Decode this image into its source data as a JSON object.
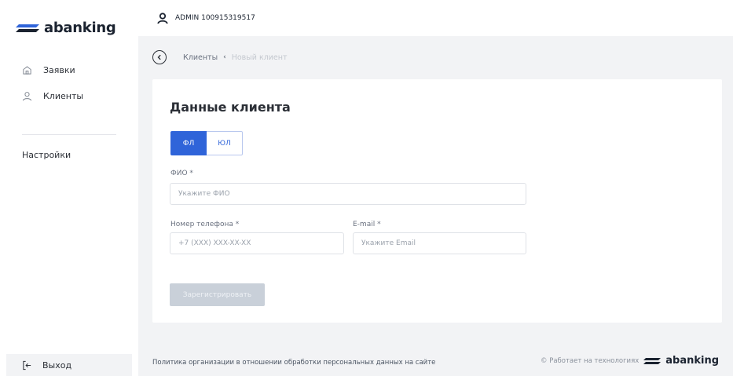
{
  "brand": {
    "name": "abanking",
    "accent": "#2f64d9"
  },
  "sidebar": {
    "items": [
      {
        "label": "Заявки",
        "icon": "home-icon"
      },
      {
        "label": "Клиенты",
        "icon": "user-icon"
      }
    ],
    "settings_label": "Настройки",
    "logout_label": "Выход"
  },
  "topbar": {
    "user_label": "ADMIN 100915319517"
  },
  "breadcrumb": {
    "parent": "Клиенты",
    "separator": "‹",
    "current": "Новый клиент"
  },
  "form": {
    "title": "Данные клиента",
    "type_options": [
      "ФЛ",
      "ЮЛ"
    ],
    "selected_type": "ФЛ",
    "fio": {
      "label": "ФИО *",
      "placeholder": "Укажите ФИО",
      "value": ""
    },
    "phone": {
      "label": "Номер телефона *",
      "placeholder": "+7 (XXX) XXX-XX-XX",
      "value": ""
    },
    "email": {
      "label": "E-mail *",
      "placeholder": "Укажите Email",
      "value": ""
    },
    "submit_label": "Зарегистрировать"
  },
  "footer": {
    "policy_link": "Политика организации в отношении обработки персональных данных на сайте",
    "powered_by": "© Работает на технологиях",
    "logo_text": "abanking"
  }
}
